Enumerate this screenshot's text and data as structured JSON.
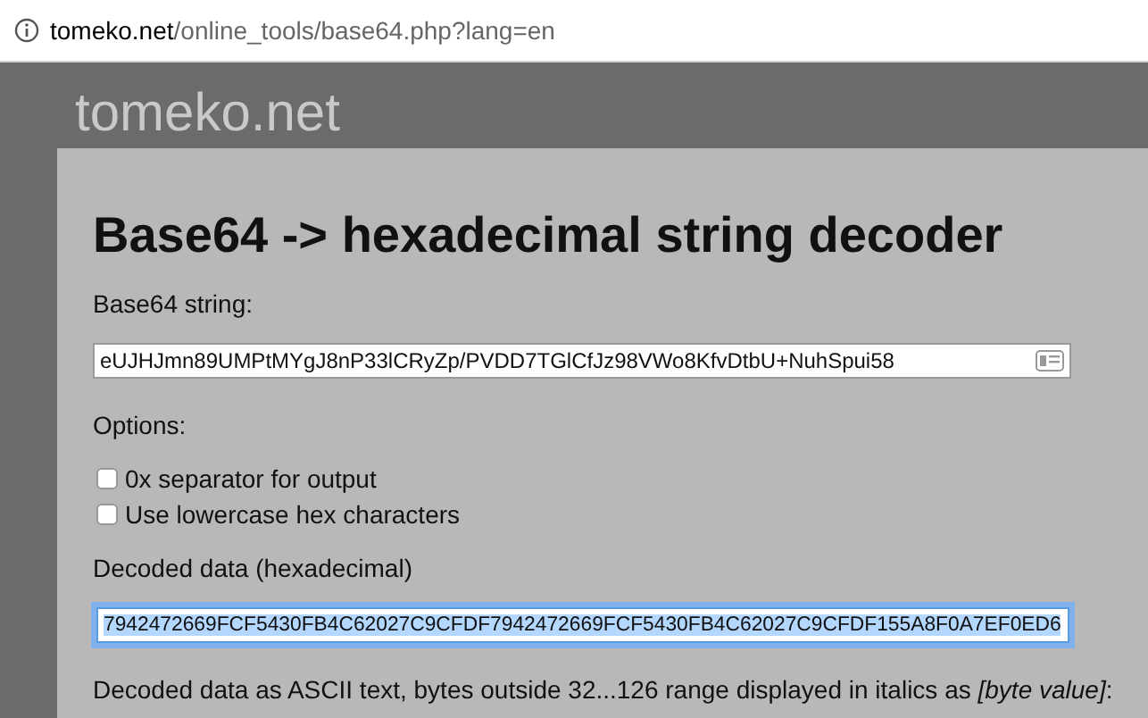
{
  "address_bar": {
    "host": "tomeko.net",
    "path": "/online_tools/base64.php?lang=en"
  },
  "site": {
    "name": "tomeko.net"
  },
  "page": {
    "title": "Base64 -> hexadecimal string decoder",
    "input_label": "Base64 string:",
    "input_value": "eUJHJmn89UMPtMYgJ8nP33lCRyZp/PVDD7TGlCfJz98VWo8KfvDtbU+NuhSpui58",
    "options_label": "Options:",
    "options": [
      {
        "label": "0x separator for output",
        "checked": false
      },
      {
        "label": "Use lowercase hex characters",
        "checked": false
      }
    ],
    "output_label": "Decoded data (hexadecimal)",
    "output_value": "7942472669FCF5430FB4C62027C9CFDF7942472669FCF5430FB4C62027C9CFDF155A8F0A7EF0ED6",
    "output_focused": true,
    "ascii_note": "Decoded data as ASCII text, bytes outside 32...126 range displayed in italics as *[byte value]*:"
  }
}
